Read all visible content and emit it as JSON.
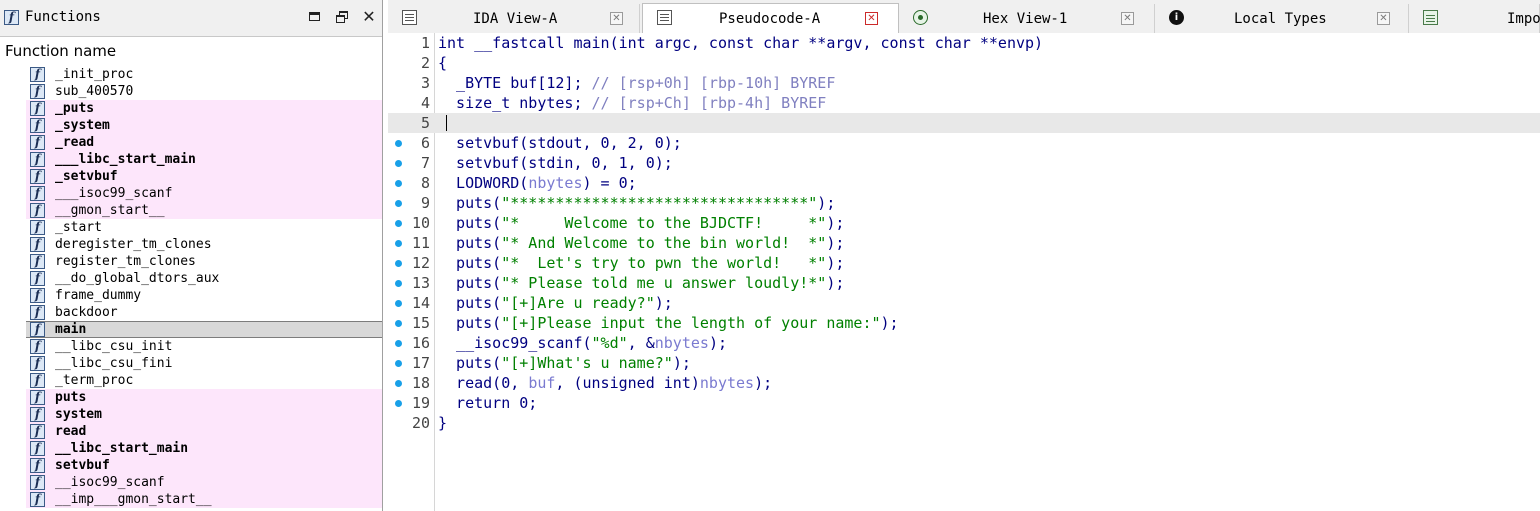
{
  "functions_panel": {
    "title": "Functions",
    "column_header": "Function name",
    "items": [
      {
        "name": "_init_proc",
        "bold": false,
        "highlight": false,
        "selected": false
      },
      {
        "name": "sub_400570",
        "bold": false,
        "highlight": false,
        "selected": false
      },
      {
        "name": "_puts",
        "bold": true,
        "highlight": true,
        "selected": false
      },
      {
        "name": "_system",
        "bold": true,
        "highlight": true,
        "selected": false
      },
      {
        "name": "_read",
        "bold": true,
        "highlight": true,
        "selected": false
      },
      {
        "name": "___libc_start_main",
        "bold": true,
        "highlight": true,
        "selected": false
      },
      {
        "name": "_setvbuf",
        "bold": true,
        "highlight": true,
        "selected": false
      },
      {
        "name": "___isoc99_scanf",
        "bold": false,
        "highlight": true,
        "selected": false
      },
      {
        "name": "__gmon_start__",
        "bold": false,
        "highlight": true,
        "selected": false
      },
      {
        "name": "_start",
        "bold": false,
        "highlight": false,
        "selected": false
      },
      {
        "name": "deregister_tm_clones",
        "bold": false,
        "highlight": false,
        "selected": false
      },
      {
        "name": "register_tm_clones",
        "bold": false,
        "highlight": false,
        "selected": false
      },
      {
        "name": "__do_global_dtors_aux",
        "bold": false,
        "highlight": false,
        "selected": false
      },
      {
        "name": "frame_dummy",
        "bold": false,
        "highlight": false,
        "selected": false
      },
      {
        "name": "backdoor",
        "bold": false,
        "highlight": false,
        "selected": false
      },
      {
        "name": "main",
        "bold": true,
        "highlight": false,
        "selected": true
      },
      {
        "name": "__libc_csu_init",
        "bold": false,
        "highlight": false,
        "selected": false
      },
      {
        "name": "__libc_csu_fini",
        "bold": false,
        "highlight": false,
        "selected": false
      },
      {
        "name": "_term_proc",
        "bold": false,
        "highlight": false,
        "selected": false
      },
      {
        "name": "puts",
        "bold": true,
        "highlight": true,
        "selected": false
      },
      {
        "name": "system",
        "bold": true,
        "highlight": true,
        "selected": false
      },
      {
        "name": "read",
        "bold": true,
        "highlight": true,
        "selected": false
      },
      {
        "name": "__libc_start_main",
        "bold": true,
        "highlight": true,
        "selected": false
      },
      {
        "name": "setvbuf",
        "bold": true,
        "highlight": true,
        "selected": false
      },
      {
        "name": "__isoc99_scanf",
        "bold": false,
        "highlight": true,
        "selected": false
      },
      {
        "name": "__imp___gmon_start__",
        "bold": false,
        "highlight": true,
        "selected": false
      }
    ]
  },
  "tabs": [
    {
      "label": "IDA View-A",
      "icon": "ida-view-icon",
      "active": false
    },
    {
      "label": "Pseudocode-A",
      "icon": "pseudocode-icon",
      "active": true
    },
    {
      "label": "Hex View-1",
      "icon": "hex-view-icon",
      "active": false
    },
    {
      "label": "Local Types",
      "icon": "local-types-icon",
      "active": false
    },
    {
      "label": "Impo",
      "icon": "imports-icon",
      "active": false
    }
  ],
  "code": {
    "lines": [
      {
        "no": "1",
        "bp": false,
        "segs": [
          [
            "t",
            "int __fastcall main(int argc, const char **argv, const char **envp)"
          ]
        ]
      },
      {
        "no": "2",
        "bp": false,
        "segs": [
          [
            "t",
            "{"
          ]
        ]
      },
      {
        "no": "3",
        "bp": false,
        "segs": [
          [
            "t",
            "  _BYTE buf[12]; "
          ],
          [
            "cm",
            "// [rsp+0h] [rbp-10h] BYREF"
          ]
        ]
      },
      {
        "no": "4",
        "bp": false,
        "segs": [
          [
            "t",
            "  size_t nbytes; "
          ],
          [
            "cm",
            "// [rsp+Ch] [rbp-4h] BYREF"
          ]
        ]
      },
      {
        "no": "5",
        "bp": false,
        "cur": true,
        "segs": []
      },
      {
        "no": "6",
        "bp": true,
        "segs": [
          [
            "t",
            "  setvbuf(stdout, 0, 2, 0);"
          ]
        ]
      },
      {
        "no": "7",
        "bp": true,
        "segs": [
          [
            "t",
            "  setvbuf(stdin, 0, 1, 0);"
          ]
        ]
      },
      {
        "no": "8",
        "bp": true,
        "segs": [
          [
            "t",
            "  LODWORD("
          ],
          [
            "var",
            "nbytes"
          ],
          [
            "t",
            ") = 0;"
          ]
        ]
      },
      {
        "no": "9",
        "bp": true,
        "segs": [
          [
            "t",
            "  puts("
          ],
          [
            "str",
            "\"*********************************\""
          ],
          [
            "t",
            ");"
          ]
        ]
      },
      {
        "no": "10",
        "bp": true,
        "segs": [
          [
            "t",
            "  puts("
          ],
          [
            "str",
            "\"*     Welcome to the BJDCTF!     *\""
          ],
          [
            "t",
            ");"
          ]
        ]
      },
      {
        "no": "11",
        "bp": true,
        "segs": [
          [
            "t",
            "  puts("
          ],
          [
            "str",
            "\"* And Welcome to the bin world!  *\""
          ],
          [
            "t",
            ");"
          ]
        ]
      },
      {
        "no": "12",
        "bp": true,
        "segs": [
          [
            "t",
            "  puts("
          ],
          [
            "str",
            "\"*  Let's try to pwn the world!   *\""
          ],
          [
            "t",
            ");"
          ]
        ]
      },
      {
        "no": "13",
        "bp": true,
        "segs": [
          [
            "t",
            "  puts("
          ],
          [
            "str",
            "\"* Please told me u answer loudly!*\""
          ],
          [
            "t",
            ");"
          ]
        ]
      },
      {
        "no": "14",
        "bp": true,
        "segs": [
          [
            "t",
            "  puts("
          ],
          [
            "str",
            "\"[+]Are u ready?\""
          ],
          [
            "t",
            ");"
          ]
        ]
      },
      {
        "no": "15",
        "bp": true,
        "segs": [
          [
            "t",
            "  puts("
          ],
          [
            "str",
            "\"[+]Please input the length of your name:\""
          ],
          [
            "t",
            ");"
          ]
        ]
      },
      {
        "no": "16",
        "bp": true,
        "segs": [
          [
            "t",
            "  __isoc99_scanf("
          ],
          [
            "str",
            "\"%d\""
          ],
          [
            "t",
            ", &"
          ],
          [
            "var",
            "nbytes"
          ],
          [
            "t",
            ");"
          ]
        ]
      },
      {
        "no": "17",
        "bp": true,
        "segs": [
          [
            "t",
            "  puts("
          ],
          [
            "str",
            "\"[+]What's u name?\""
          ],
          [
            "t",
            ");"
          ]
        ]
      },
      {
        "no": "18",
        "bp": true,
        "segs": [
          [
            "t",
            "  read(0, "
          ],
          [
            "var",
            "buf"
          ],
          [
            "t",
            ", (unsigned int)"
          ],
          [
            "var",
            "nbytes"
          ],
          [
            "t",
            ");"
          ]
        ]
      },
      {
        "no": "19",
        "bp": true,
        "segs": [
          [
            "t",
            "  return 0;"
          ]
        ]
      },
      {
        "no": "20",
        "bp": false,
        "segs": [
          [
            "t",
            "}"
          ]
        ]
      }
    ]
  },
  "colors": {
    "code_keyword": "#000080",
    "comment": "#8080c0",
    "string": "#008000",
    "variable": "#7a7ad0",
    "breakpoint": "#19a0e8",
    "import_highlight": "#fde6fb"
  }
}
